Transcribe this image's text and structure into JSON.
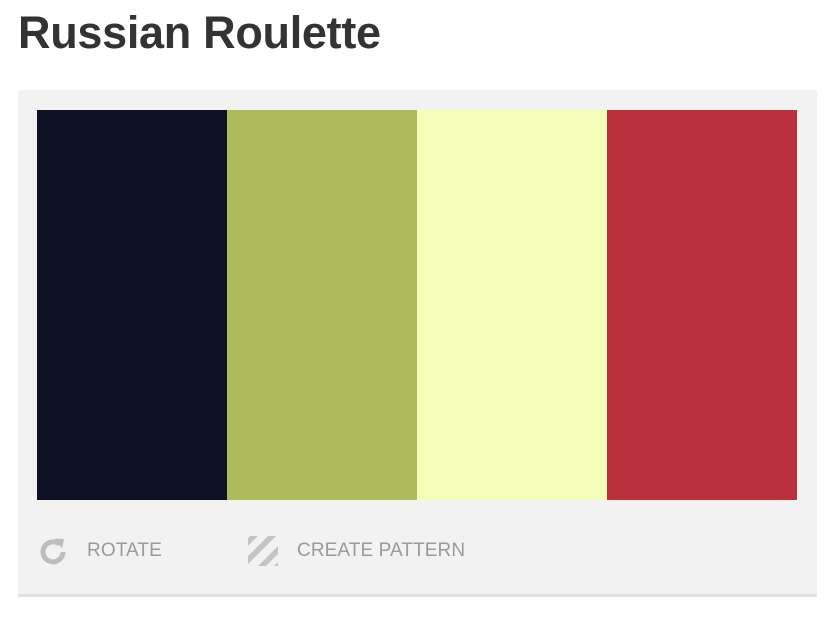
{
  "page": {
    "title": "Russian Roulette"
  },
  "palette": {
    "swatches": [
      {
        "name": "swatch-1",
        "color": "#0e1124"
      },
      {
        "name": "swatch-2",
        "color": "#adbb5a"
      },
      {
        "name": "swatch-3",
        "color": "#f5feb8"
      },
      {
        "name": "swatch-4",
        "color": "#ba313b"
      }
    ]
  },
  "actions": {
    "rotate_label": "ROTATE",
    "rotate_icon": "rotate-icon",
    "pattern_label": "CREATE PATTERN",
    "pattern_icon": "pattern-stripes-icon"
  }
}
